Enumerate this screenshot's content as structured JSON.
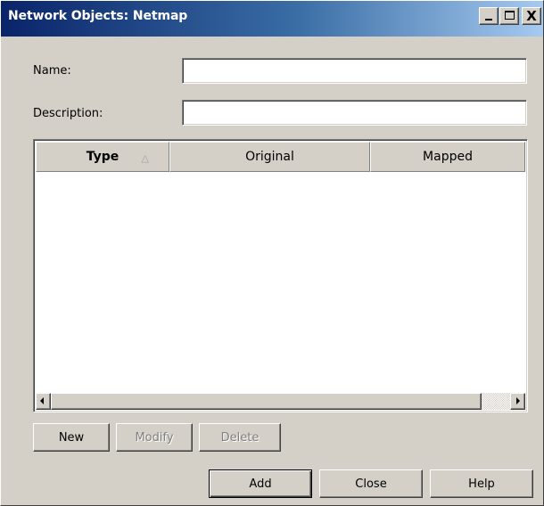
{
  "window": {
    "title": "Network Objects: Netmap",
    "controls": {
      "minimize": "_",
      "maximize": "□",
      "close": "X"
    }
  },
  "form": {
    "name_label": "Name:",
    "name_value": "",
    "description_label": "Description:",
    "description_value": ""
  },
  "table": {
    "columns": [
      "Type",
      "Original",
      "Mapped"
    ],
    "sorted_column": "Type",
    "sort_direction": "ascending",
    "sort_glyph": "△",
    "rows": []
  },
  "list_buttons": {
    "new": "New",
    "modify": "Modify",
    "delete": "Delete"
  },
  "dialog_buttons": {
    "add": "Add",
    "close": "Close",
    "help": "Help"
  },
  "colors": {
    "titlebar_start": "#0a246a",
    "titlebar_end": "#a6caf0",
    "window_face": "#d4d0c8"
  }
}
